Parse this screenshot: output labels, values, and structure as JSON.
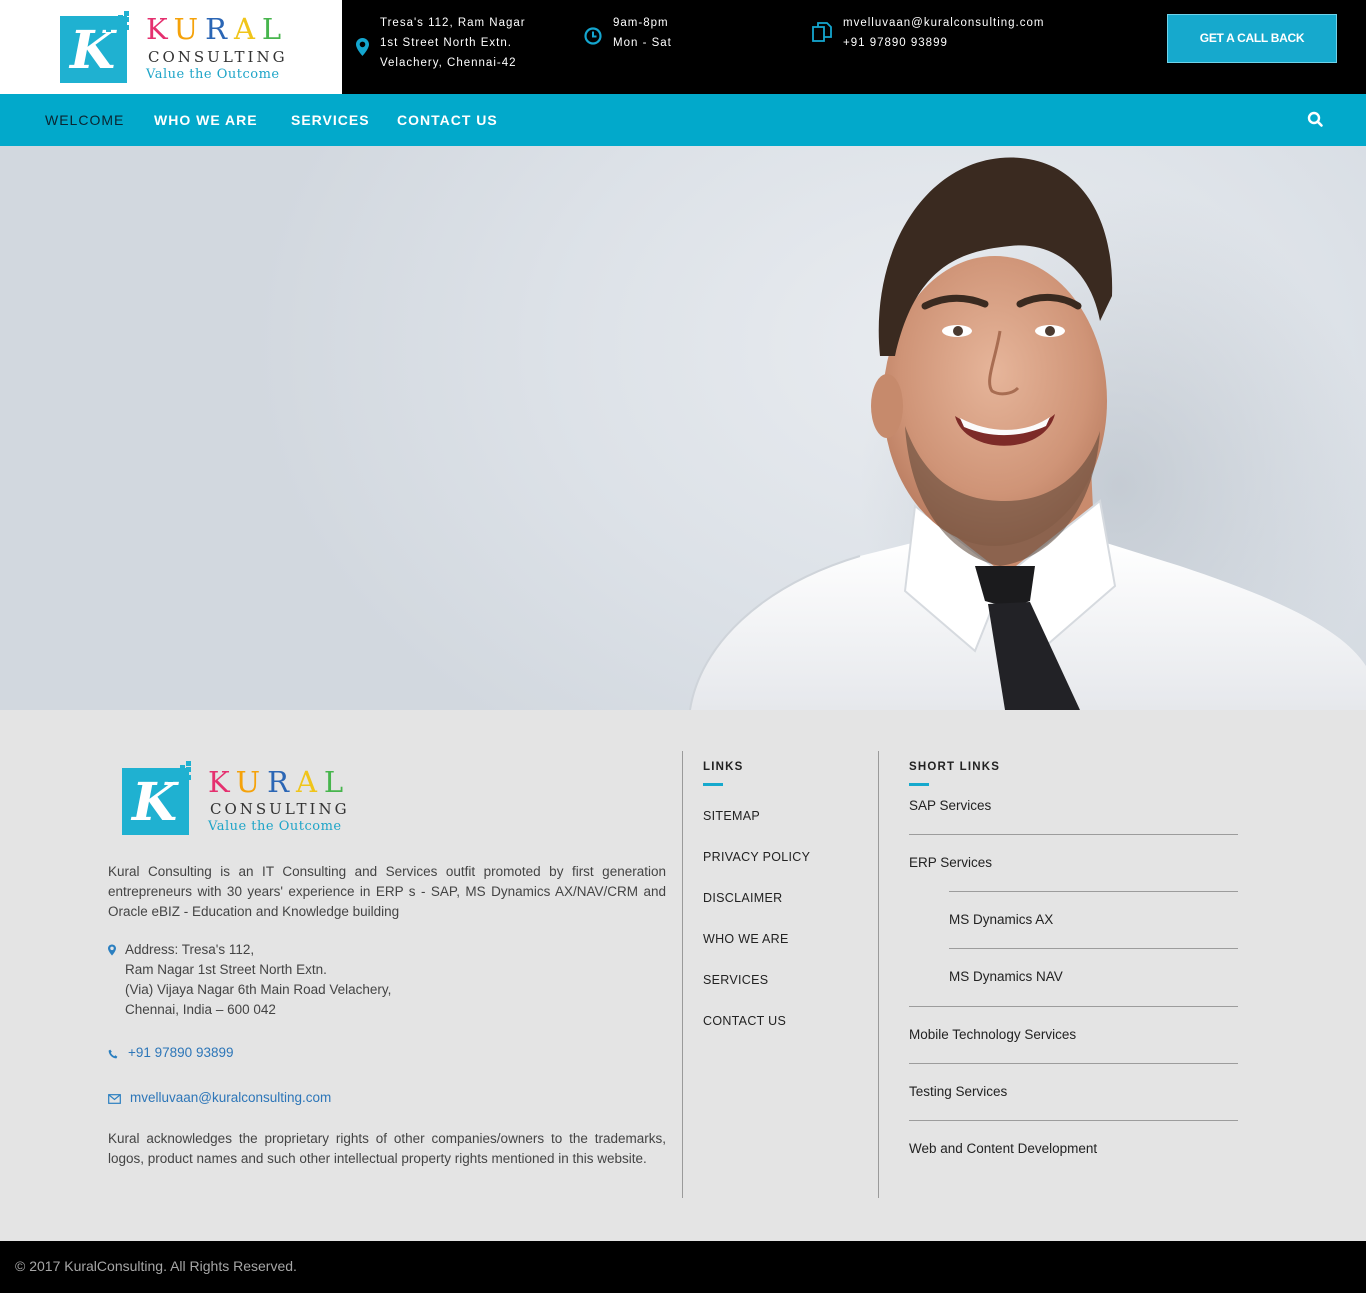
{
  "header": {
    "logo": {
      "letter": "K",
      "brand_letters": [
        "K",
        "U",
        "R",
        "A",
        "L"
      ],
      "subtitle": "CONSULTING",
      "tagline": "Value the Outcome"
    },
    "address": {
      "icon": "map-marker-icon",
      "lines": [
        "Tresa's 112, Ram Nagar",
        "1st Street North Extn.",
        "Velachery, Chennai-42"
      ]
    },
    "hours": {
      "icon": "clock-icon",
      "lines": [
        "9am-8pm",
        "Mon - Sat"
      ]
    },
    "contact": {
      "icon": "copy-icon",
      "lines": [
        "mvelluvaan@kuralconsulting.com",
        "+91 97890 93899"
      ]
    },
    "cta_label": "GET A CALL BACK"
  },
  "nav": {
    "items": [
      {
        "label": "WELCOME",
        "active": true
      },
      {
        "label": "WHO WE ARE",
        "active": false
      },
      {
        "label": "SERVICES",
        "active": false
      },
      {
        "label": "CONTACT US",
        "active": false
      }
    ],
    "search_icon": "search-icon"
  },
  "colors": {
    "accent": "#02a9cb",
    "topbar_bg": "#000000",
    "footer_bg": "#e4e4e4",
    "link": "#2d76b8"
  },
  "footer": {
    "about": "Kural Consulting is an IT Consulting and Services outfit promoted by first generation entrepreneurs with 30 years' experience in ERP s - SAP, MS Dynamics AX/NAV/CRM and Oracle eBIZ - Education and Knowledge building",
    "address": {
      "icon": "map-marker-icon",
      "lines": [
        "Address: Tresa's 112,",
        "Ram Nagar 1st Street North Extn.",
        "(Via) Vijaya Nagar 6th Main Road Velachery,",
        "Chennai, India – 600 042"
      ]
    },
    "phone": {
      "icon": "phone-icon",
      "text": "+91 97890 93899"
    },
    "email": {
      "icon": "envelope-icon",
      "text": "mvelluvaan@kuralconsulting.com"
    },
    "legal": "Kural acknowledges the proprietary rights of other companies/owners to the trademarks, logos, product names and such other intellectual property rights mentioned in this website.",
    "links": {
      "title": "LINKS",
      "items": [
        "SITEMAP",
        "PRIVACY POLICY",
        "DISCLAIMER",
        "WHO WE ARE",
        "SERVICES",
        "CONTACT US"
      ]
    },
    "short_links": {
      "title": "SHORT LINKS",
      "items": [
        {
          "label": "SAP Services",
          "sub": false
        },
        {
          "label": "ERP Services",
          "sub": false
        },
        {
          "label": "MS Dynamics AX",
          "sub": true
        },
        {
          "label": "MS Dynamics NAV",
          "sub": true
        },
        {
          "label": "Mobile Technology Services",
          "sub": false
        },
        {
          "label": "Testing Services",
          "sub": false
        },
        {
          "label": "Web and Content Development",
          "sub": false
        }
      ]
    },
    "copyright": "© 2017 KuralConsulting. All Rights Reserved."
  }
}
